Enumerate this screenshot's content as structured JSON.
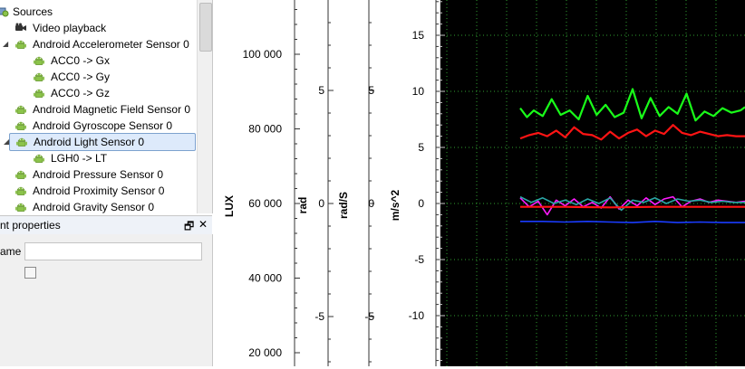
{
  "tree": {
    "root_label": "Sources",
    "items": [
      {
        "label": "Video playback",
        "icon": "video-camera-icon"
      },
      {
        "label": "Android Accelerometer Sensor 0",
        "icon": "android-icon"
      },
      {
        "label": "ACC0 -> Gx",
        "icon": "android-icon"
      },
      {
        "label": "ACC0 -> Gy",
        "icon": "android-icon"
      },
      {
        "label": "ACC0 -> Gz",
        "icon": "android-icon"
      },
      {
        "label": "Android Magnetic Field Sensor 0",
        "icon": "android-icon"
      },
      {
        "label": "Android Gyroscope Sensor 0",
        "icon": "android-icon"
      },
      {
        "label": "Android Light Sensor 0",
        "icon": "android-icon",
        "selected": true
      },
      {
        "label": "LGH0 -> LT",
        "icon": "android-icon"
      },
      {
        "label": "Android Pressure Sensor 0",
        "icon": "android-icon"
      },
      {
        "label": "Android Proximity Sensor 0",
        "icon": "android-icon"
      },
      {
        "label": "Android Gravity Sensor 0",
        "icon": "android-icon"
      }
    ]
  },
  "properties": {
    "title": "nt properties",
    "float_button": "🗗",
    "close_button": "✕",
    "name_label": "ame",
    "name_value": "",
    "checkbox_checked": false
  },
  "colors": {
    "android_green": "#8bc34a",
    "grid": "#2f9e2f",
    "series_green": "#19ff19",
    "series_red": "#ff1414",
    "series_blue": "#1a3cff",
    "series_magenta": "#ff1aff",
    "series_teal": "#2aa6a6"
  },
  "chart_data": {
    "type": "line",
    "axes": [
      {
        "label": "LUX",
        "ticks": [
          20000,
          40000,
          60000,
          80000,
          100000
        ],
        "tick_labels": [
          "20 000",
          "40 000",
          "60 000",
          "80 000",
          "100 000"
        ]
      },
      {
        "label": "rad",
        "ticks": [
          -5,
          0,
          5
        ],
        "tick_labels": [
          "-5",
          "0",
          "5"
        ]
      },
      {
        "label": "rad/S",
        "ticks": [
          -5,
          0,
          5
        ],
        "tick_labels": [
          "-5",
          "0",
          "5"
        ]
      },
      {
        "label": "m/s^2",
        "ticks": [
          -10,
          -5,
          0,
          5,
          10,
          15
        ],
        "tick_labels": [
          "-10",
          "-5",
          "0",
          "5",
          "10",
          "15"
        ]
      }
    ],
    "ylim_ms2": [
      -14.5,
      18
    ],
    "grid": true,
    "series": [
      {
        "color": "green",
        "x": [
          0.0,
          0.03,
          0.06,
          0.1,
          0.14,
          0.18,
          0.22,
          0.26,
          0.3,
          0.34,
          0.38,
          0.42,
          0.46,
          0.5,
          0.54,
          0.58,
          0.62,
          0.66,
          0.7,
          0.74,
          0.78,
          0.82,
          0.86,
          0.9,
          0.94,
          0.98,
          1.0
        ],
        "y": [
          8.5,
          7.7,
          8.3,
          7.8,
          9.3,
          7.9,
          8.3,
          7.5,
          9.6,
          7.9,
          8.8,
          7.7,
          8.1,
          10.2,
          7.6,
          9.4,
          7.8,
          8.6,
          8.0,
          9.8,
          7.4,
          8.2,
          7.8,
          8.5,
          8.1,
          8.3,
          8.6
        ]
      },
      {
        "color": "red",
        "x": [
          0.0,
          0.04,
          0.08,
          0.12,
          0.16,
          0.2,
          0.24,
          0.28,
          0.32,
          0.36,
          0.4,
          0.44,
          0.48,
          0.52,
          0.56,
          0.6,
          0.64,
          0.68,
          0.72,
          0.76,
          0.8,
          0.84,
          0.88,
          0.92,
          0.96,
          1.0
        ],
        "y": [
          5.8,
          6.1,
          6.3,
          6.0,
          6.5,
          5.9,
          6.8,
          6.2,
          6.1,
          5.7,
          6.4,
          5.8,
          6.3,
          6.6,
          6.0,
          6.5,
          6.2,
          7.0,
          6.3,
          6.1,
          6.4,
          6.2,
          6.0,
          6.1,
          6.0,
          6.0
        ]
      },
      {
        "color": "blue",
        "x": [
          0.0,
          0.1,
          0.2,
          0.3,
          0.4,
          0.5,
          0.6,
          0.7,
          0.8,
          0.9,
          1.0
        ],
        "y": [
          -1.6,
          -1.6,
          -1.65,
          -1.6,
          -1.65,
          -1.7,
          -1.6,
          -1.7,
          -1.65,
          -1.7,
          -1.7
        ]
      },
      {
        "color": "magenta",
        "x": [
          0.0,
          0.04,
          0.08,
          0.12,
          0.16,
          0.2,
          0.24,
          0.28,
          0.32,
          0.36,
          0.4,
          0.44,
          0.48,
          0.52,
          0.56,
          0.6,
          0.64,
          0.68,
          0.72,
          0.76,
          0.8,
          0.84,
          0.88,
          0.92,
          0.96,
          1.0
        ],
        "y": [
          0.5,
          -0.3,
          0.2,
          -1.0,
          0.3,
          -0.2,
          0.4,
          -0.3,
          0.1,
          -0.4,
          0.6,
          -0.5,
          0.3,
          -0.2,
          0.5,
          -0.1,
          0.4,
          0.6,
          -0.3,
          0.2,
          0.4,
          0.1,
          0.3,
          0.2,
          0.1,
          0.2
        ]
      },
      {
        "color": "teal",
        "x": [
          0.0,
          0.05,
          0.1,
          0.15,
          0.2,
          0.25,
          0.3,
          0.35,
          0.4,
          0.45,
          0.5,
          0.55,
          0.6,
          0.65,
          0.7,
          0.75,
          0.8,
          0.85,
          0.9,
          0.95,
          1.0
        ],
        "y": [
          0.6,
          0.1,
          0.5,
          0.0,
          0.3,
          -0.1,
          0.4,
          0.0,
          0.5,
          -0.6,
          0.3,
          0.1,
          0.5,
          0.0,
          0.4,
          0.2,
          0.3,
          0.1,
          0.2,
          0.1,
          0.1
        ]
      },
      {
        "color": "red",
        "x": [
          0.0,
          0.2,
          0.4,
          0.6,
          0.8,
          1.0
        ],
        "y": [
          -0.3,
          -0.3,
          -0.35,
          -0.3,
          -0.3,
          -0.3
        ]
      }
    ]
  }
}
